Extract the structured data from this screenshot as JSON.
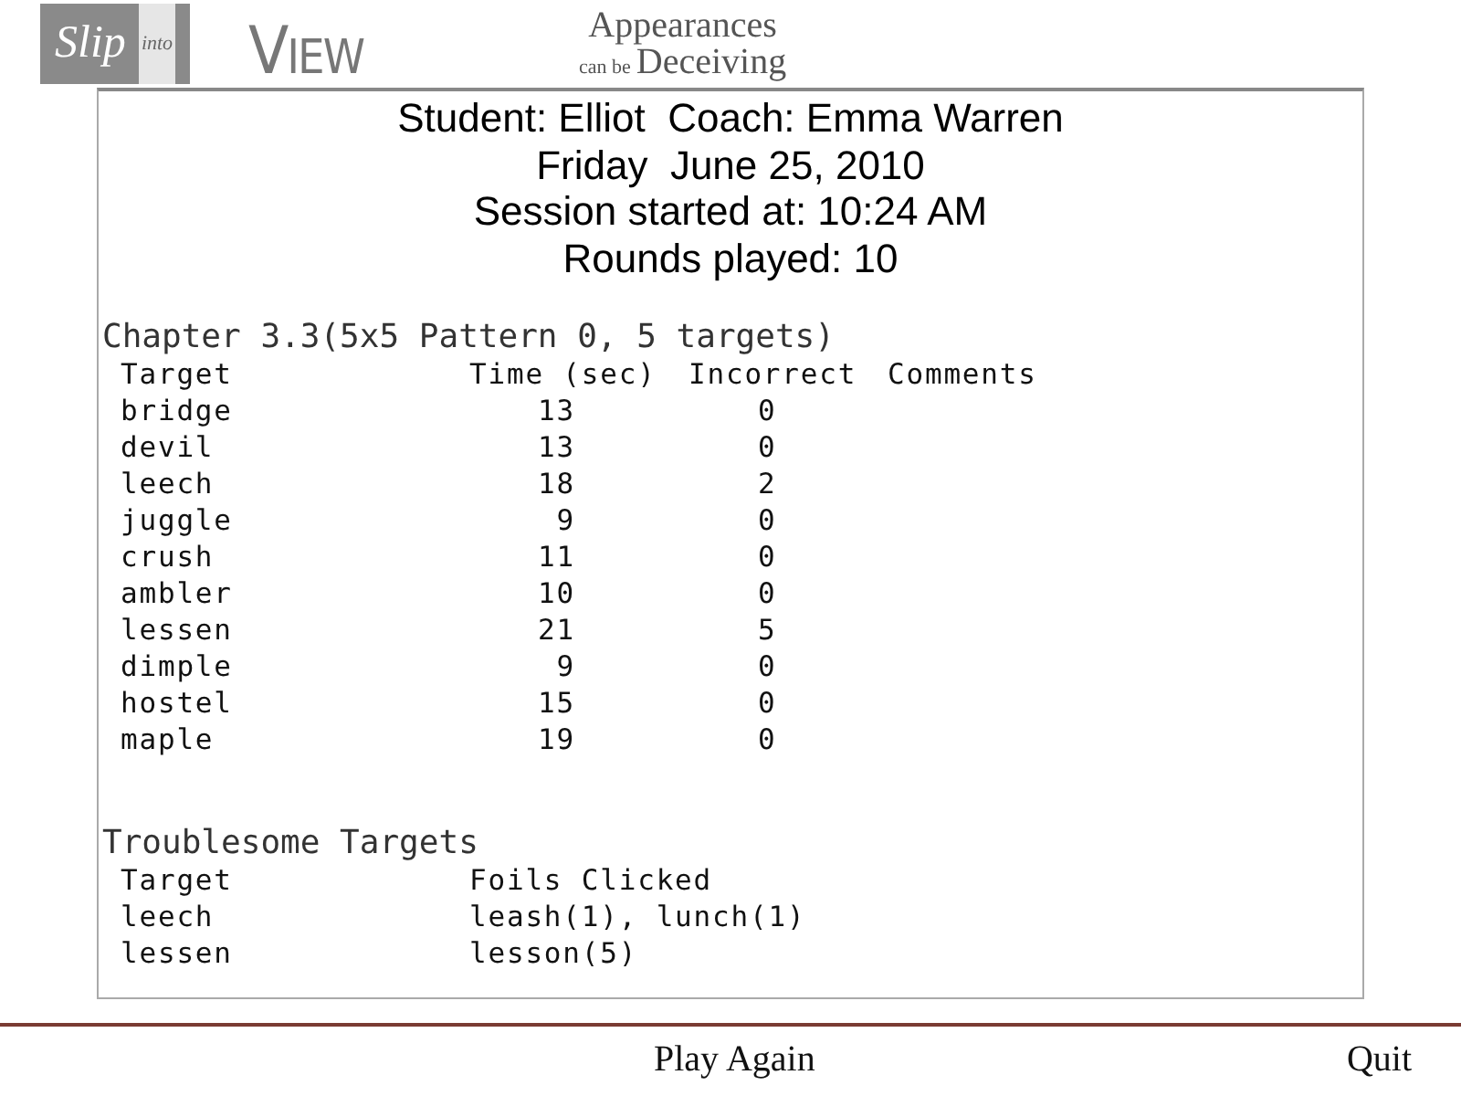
{
  "header": {
    "logo": {
      "script": "Slip",
      "vertical": "into"
    },
    "brand": "VIEW",
    "tagline": {
      "top": "Appearances",
      "small": "can be",
      "large": "Deceiving"
    }
  },
  "summary": [
    "Student: Elliot  Coach: Emma Warren",
    "Friday  June 25, 2010",
    "Session started at: 10:24 AM",
    "Rounds played: 10"
  ],
  "chapter": {
    "title": "Chapter 3.3(5x5 Pattern 0, 5 targets)",
    "columns": [
      "Target",
      "Time (sec)",
      "Incorrect",
      "Comments"
    ],
    "rows": [
      {
        "target": "bridge",
        "time": "13",
        "incorrect": "0"
      },
      {
        "target": "devil",
        "time": "13",
        "incorrect": "0"
      },
      {
        "target": "leech",
        "time": "18",
        "incorrect": "2"
      },
      {
        "target": "juggle",
        "time": "9",
        "incorrect": "0"
      },
      {
        "target": "crush",
        "time": "11",
        "incorrect": "0"
      },
      {
        "target": "ambler",
        "time": "10",
        "incorrect": "0"
      },
      {
        "target": "lessen",
        "time": "21",
        "incorrect": "5"
      },
      {
        "target": "dimple",
        "time": "9",
        "incorrect": "0"
      },
      {
        "target": "hostel",
        "time": "15",
        "incorrect": "0"
      },
      {
        "target": "maple",
        "time": "19",
        "incorrect": "0"
      }
    ]
  },
  "troublesome": {
    "title": "Troublesome Targets",
    "columns": [
      "Target",
      "Foils Clicked"
    ],
    "rows": [
      {
        "target": "leech",
        "foils": "leash(1), lunch(1)"
      },
      {
        "target": "lessen",
        "foils": "lesson(5)"
      }
    ]
  },
  "footer": {
    "buttons": [
      "Play Again",
      "Quit"
    ]
  }
}
